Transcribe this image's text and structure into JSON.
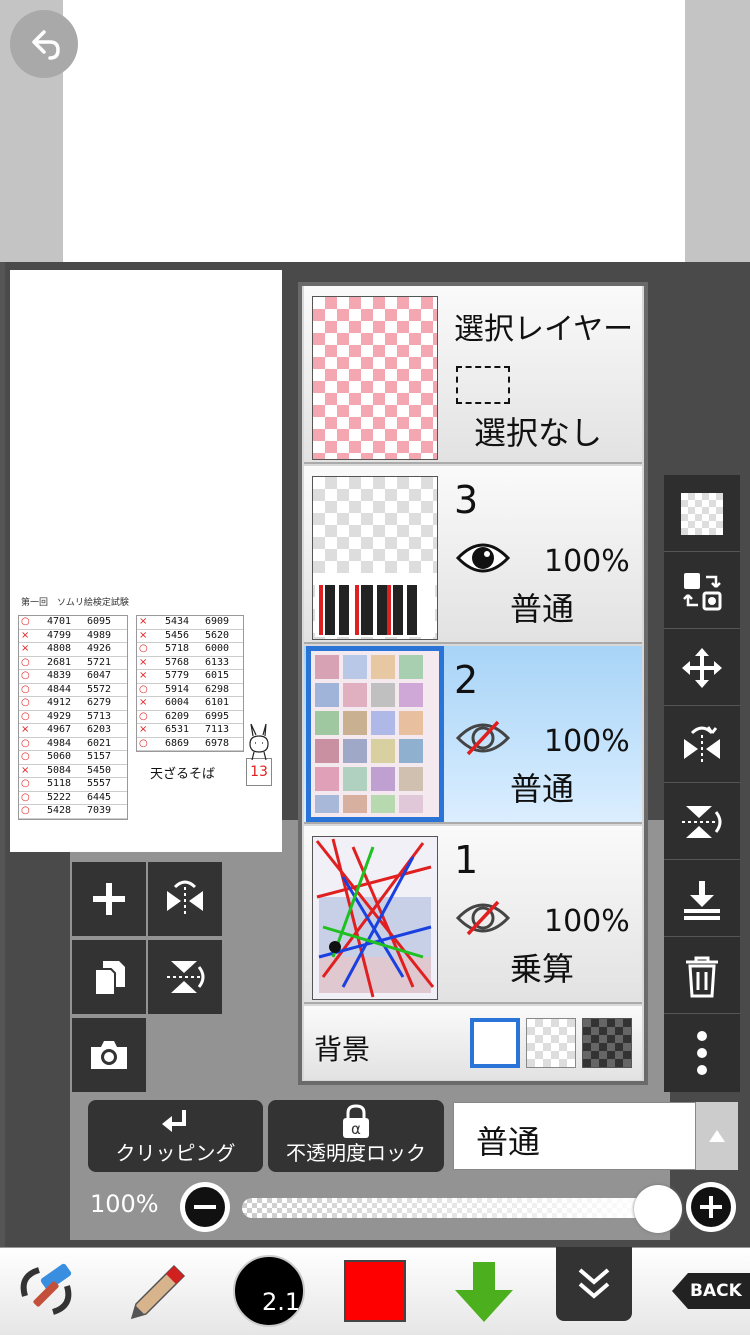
{
  "preview": {
    "title": "第一回　ソムリ絵検定試験",
    "table_left": [
      {
        "mark": "○",
        "a": "4701",
        "b": "6095"
      },
      {
        "mark": "×",
        "a": "4799",
        "b": "4989"
      },
      {
        "mark": "×",
        "a": "4808",
        "b": "4926"
      },
      {
        "mark": "○",
        "a": "2681",
        "b": "5721"
      },
      {
        "mark": "○",
        "a": "4839",
        "b": "6047"
      },
      {
        "mark": "○",
        "a": "4844",
        "b": "5572"
      },
      {
        "mark": "○",
        "a": "4912",
        "b": "6279"
      },
      {
        "mark": "○",
        "a": "4929",
        "b": "5713"
      },
      {
        "mark": "×",
        "a": "4967",
        "b": "6203"
      },
      {
        "mark": "○",
        "a": "4984",
        "b": "6021"
      },
      {
        "mark": "○",
        "a": "5060",
        "b": "5157"
      },
      {
        "mark": "×",
        "a": "5084",
        "b": "5450"
      },
      {
        "mark": "○",
        "a": "5118",
        "b": "5557"
      },
      {
        "mark": "○",
        "a": "5222",
        "b": "6445"
      },
      {
        "mark": "○",
        "a": "5428",
        "b": "7039"
      }
    ],
    "table_right": [
      {
        "mark": "×",
        "a": "5434",
        "b": "6909"
      },
      {
        "mark": "×",
        "a": "5456",
        "b": "5620"
      },
      {
        "mark": "○",
        "a": "5718",
        "b": "6000"
      },
      {
        "mark": "×",
        "a": "5768",
        "b": "6133"
      },
      {
        "mark": "×",
        "a": "5779",
        "b": "6015"
      },
      {
        "mark": "○",
        "a": "5914",
        "b": "6298"
      },
      {
        "mark": "×",
        "a": "6004",
        "b": "6101"
      },
      {
        "mark": "○",
        "a": "6209",
        "b": "6995"
      },
      {
        "mark": "×",
        "a": "6531",
        "b": "7113"
      },
      {
        "mark": "○",
        "a": "6869",
        "b": "6978"
      }
    ],
    "name": "天ざるそば",
    "score": "13"
  },
  "layers": {
    "selection": {
      "title": "選択レイヤー",
      "state": "選択なし"
    },
    "items": [
      {
        "number": "3",
        "opacity": "100%",
        "blend": "普通",
        "visible": true
      },
      {
        "number": "2",
        "opacity": "100%",
        "blend": "普通",
        "visible": false
      },
      {
        "number": "1",
        "opacity": "100%",
        "blend": "乗算",
        "visible": false
      }
    ],
    "background_label": "背景"
  },
  "controls": {
    "clipping_label": "クリッピング",
    "alpha_lock_label": "不透明度ロック",
    "blend_mode": "普通",
    "opacity_label": "100%",
    "opacity_value": 1.0
  },
  "toolbar": {
    "brush_size": "2.1",
    "color": "#ff0000",
    "back_label": "BACK"
  },
  "colors": {
    "accent": "#2a74d8",
    "selected_layer": "#a8d4f7",
    "download_green": "#4caf1e"
  }
}
